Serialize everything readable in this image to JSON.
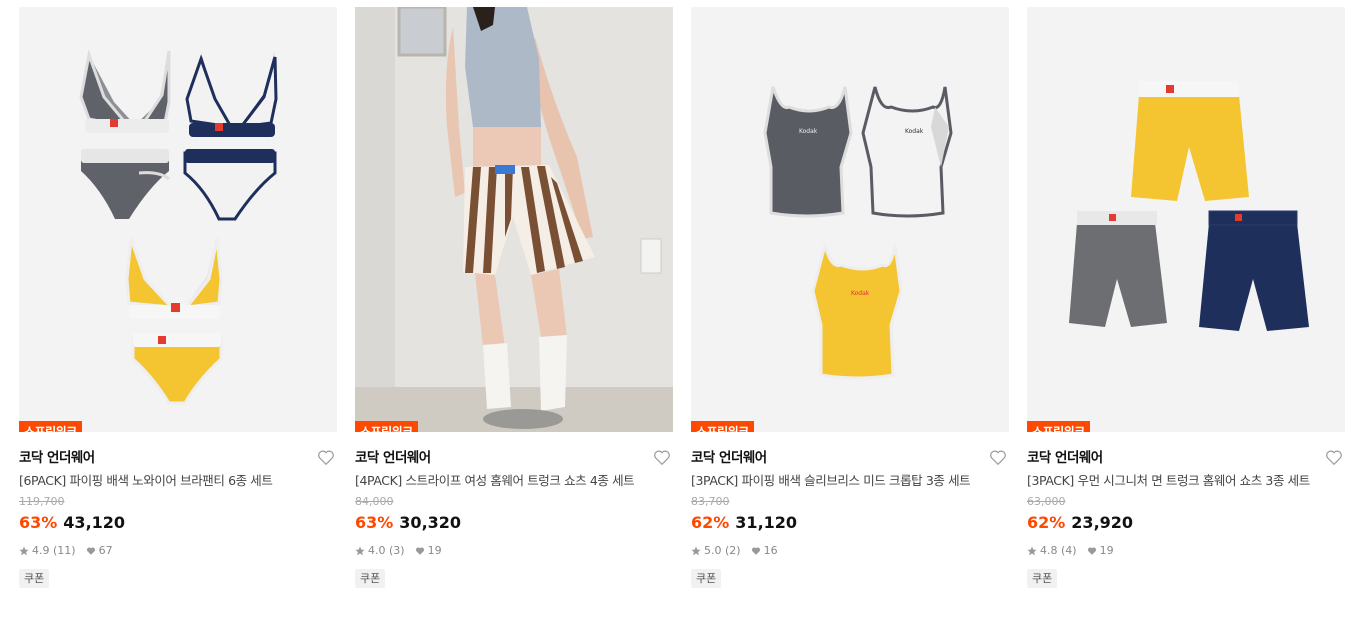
{
  "products": [
    {
      "badge": "스프링위크",
      "brand": "코닥 언더웨어",
      "title": "[6PACK] 파이핑 배색 노와이어 브라팬티 6종 세트",
      "original_price": "119,700",
      "discount": "63%",
      "price": "43,120",
      "rating": "4.9",
      "reviews": "(11)",
      "likes": "67",
      "coupon": "쿠폰"
    },
    {
      "badge": "스프링위크",
      "brand": "코닥 언더웨어",
      "title": "[4PACK] 스트라이프 여성 홈웨어 트렁크 쇼츠 4종 세트",
      "original_price": "84,000",
      "discount": "63%",
      "price": "30,320",
      "rating": "4.0",
      "reviews": "(3)",
      "likes": "19",
      "coupon": "쿠폰"
    },
    {
      "badge": "스프링위크",
      "brand": "코닥 언더웨어",
      "title": "[3PACK] 파이핑 배색 슬리브리스 미드 크롭탑 3종 세트",
      "original_price": "83,700",
      "discount": "62%",
      "price": "31,120",
      "rating": "5.0",
      "reviews": "(2)",
      "likes": "16",
      "coupon": "쿠폰"
    },
    {
      "badge": "스프링위크",
      "brand": "코닥 언더웨어",
      "title": "[3PACK] 우먼 시그니처 면 트렁크 홈웨어 쇼츠 3종 세트",
      "original_price": "63,000",
      "discount": "62%",
      "price": "23,920",
      "rating": "4.8",
      "reviews": "(4)",
      "likes": "19",
      "coupon": "쿠폰"
    }
  ],
  "icons": {
    "like": "heart-outline-icon",
    "rating": "star-icon",
    "likes": "heart-filled-icon"
  },
  "colors": {
    "accent": "#ff4800",
    "thumb_bg": "#f3f3f3",
    "yellow": "#f4c531",
    "navy": "#1e2f5c",
    "charcoal": "#5a5c64"
  },
  "image_text": {
    "logo_word": "Kodak"
  }
}
